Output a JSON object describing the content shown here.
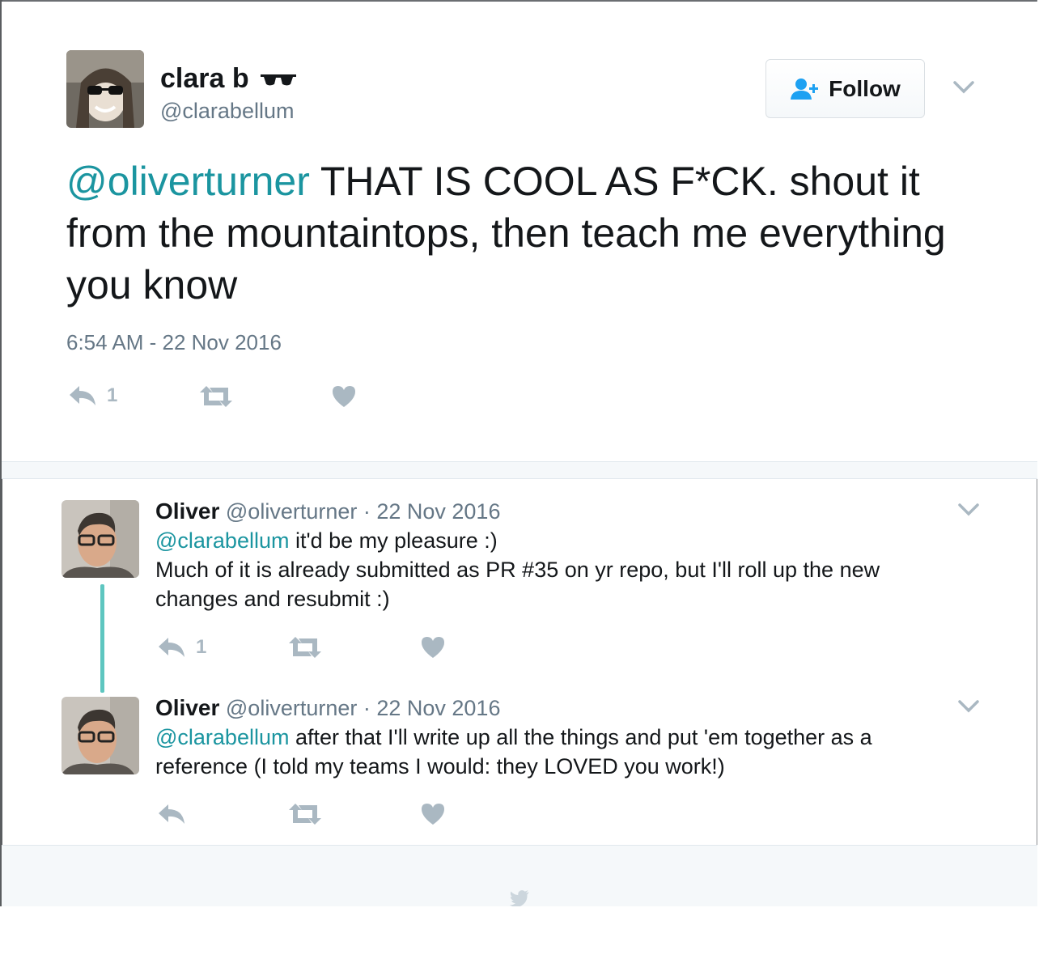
{
  "main_tweet": {
    "author_name": "clara b",
    "author_handle": "@clarabellum",
    "follow_label": "Follow",
    "mention": "@oliverturner",
    "text": " THAT IS COOL AS F*CK. shout it from the mountaintops, then teach me everything you know",
    "timestamp": "6:54 AM - 22 Nov 2016",
    "reply_count": "1"
  },
  "replies": [
    {
      "author_name": "Oliver",
      "meta": " @oliverturner · 22 Nov 2016",
      "mention": "@clarabellum",
      "text_line1": " it'd be my pleasure :)",
      "text_rest": "Much of it is already submitted as PR #35 on yr repo, but I'll roll up the new changes and resubmit :)",
      "reply_count": "1"
    },
    {
      "author_name": "Oliver",
      "meta": " @oliverturner · 22 Nov 2016",
      "mention": "@clarabellum",
      "text_line1": " after that I'll write up all the things and put 'em together as a reference (I told my teams I would: they LOVED you work!)",
      "text_rest": "",
      "reply_count": ""
    }
  ],
  "colors": {
    "mention": "#1b95a0",
    "icon": "#aab8c2",
    "thread": "#5ec6c0",
    "follow_icon": "#1da1f2"
  }
}
